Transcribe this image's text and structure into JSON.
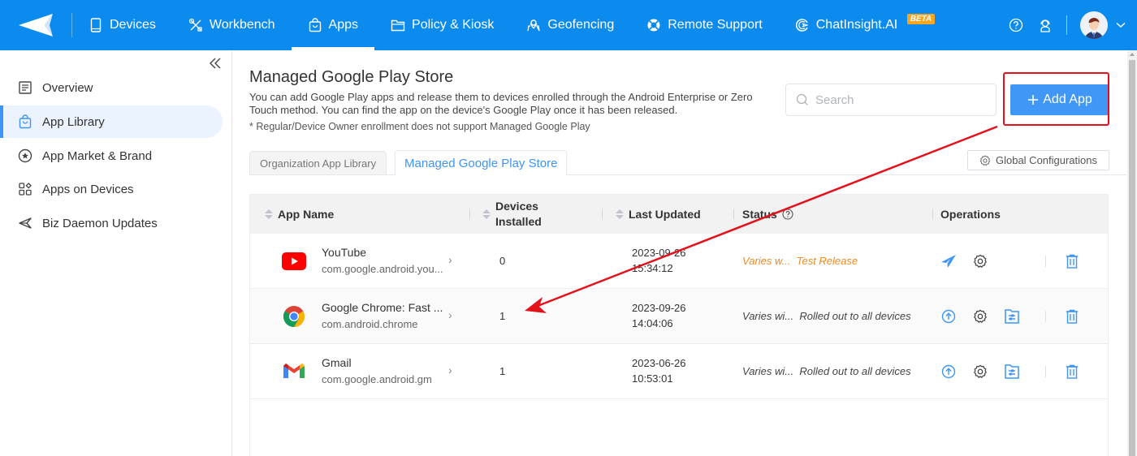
{
  "topnav": {
    "items": [
      {
        "label": "Devices",
        "icon": "tablet-icon"
      },
      {
        "label": "Workbench",
        "icon": "tools-icon"
      },
      {
        "label": "Apps",
        "icon": "shopping-bag-icon",
        "active": true
      },
      {
        "label": "Policy & Kiosk",
        "icon": "folder-icon"
      },
      {
        "label": "Geofencing",
        "icon": "map-pin-icon"
      },
      {
        "label": "Remote Support",
        "icon": "lifebuoy-icon"
      },
      {
        "label": "ChatInsight.AI",
        "icon": "chat-ai-icon",
        "badge": "BETA"
      }
    ],
    "brand_color": "#0a8bed"
  },
  "sidebar": {
    "items": [
      {
        "label": "Overview",
        "icon": "document-icon"
      },
      {
        "label": "App Library",
        "icon": "shopping-bag-icon",
        "active": true
      },
      {
        "label": "App Market & Brand",
        "icon": "star-circle-icon"
      },
      {
        "label": "Apps on Devices",
        "icon": "grid-apps-icon"
      },
      {
        "label": "Biz Daemon Updates",
        "icon": "send-icon"
      }
    ]
  },
  "main": {
    "title": "Managed Google Play Store",
    "description": "You can add Google Play apps and release them to devices enrolled through the Android Enterprise or Zero Touch method. You can find the app on the device's Google Play once it has been released.",
    "note": "* Regular/Device Owner enrollment does not support Managed Google Play",
    "search_placeholder": "Search",
    "add_app_label": "Add App",
    "tabs": [
      {
        "label": "Organization App Library",
        "active": false
      },
      {
        "label": "Managed Google Play Store",
        "active": true
      }
    ],
    "global_config_label": "Global Configurations",
    "accent_color": "#4097f5"
  },
  "table": {
    "columns": {
      "app_name": "App Name",
      "devices_installed_1": "Devices",
      "devices_installed_2": "Installed",
      "last_updated": "Last Updated",
      "status": "Status",
      "operations": "Operations"
    },
    "rows": [
      {
        "name": "YouTube",
        "package": "com.google.android.you...",
        "devices": "0",
        "date": "2023-09-26",
        "time": "15:34:12",
        "status_prefix": "Varies w...",
        "status": "Test Release",
        "status_color": "#f08a24"
      },
      {
        "name": "Google Chrome: Fast ...",
        "package": "com.android.chrome",
        "devices": "1",
        "date": "2023-09-26",
        "time": "14:04:06",
        "status_prefix": "Varies wi...",
        "status": "Rolled out to all devices",
        "status_color": "#444444"
      },
      {
        "name": "Gmail",
        "package": "com.google.android.gm",
        "devices": "1",
        "date": "2023-06-26",
        "time": "10:53:01",
        "status_prefix": "Varies wi...",
        "status": "Rolled out to all devices",
        "status_color": "#444444"
      }
    ]
  },
  "annotation": {
    "color": "#e4101c"
  }
}
